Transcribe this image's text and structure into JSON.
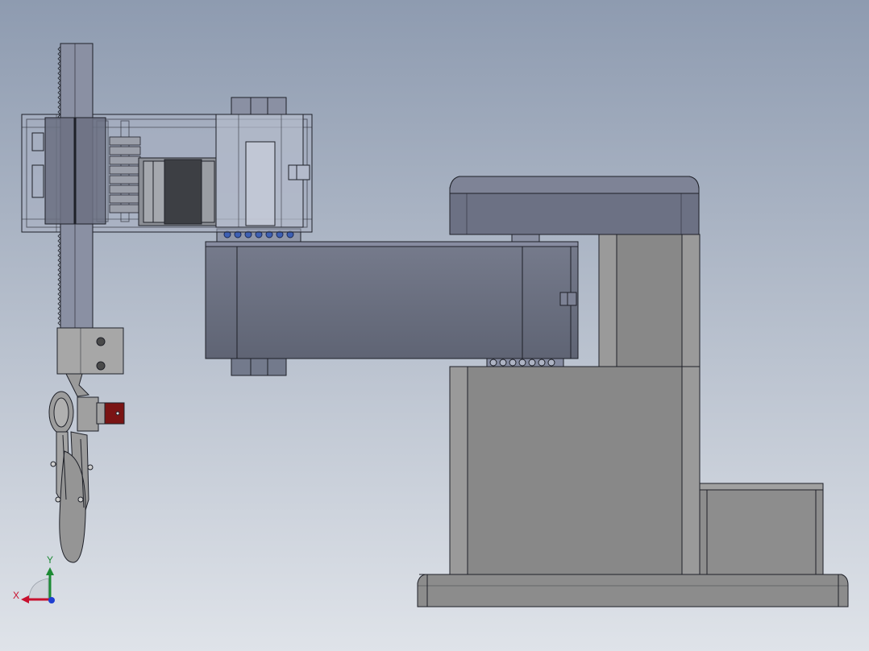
{
  "viewport": {
    "background_top": "#8e9bb0",
    "background_bottom": "#dfe3e9"
  },
  "triad": {
    "x_label": "X",
    "y_label": "Y",
    "x_color": "#c8102e",
    "y_color": "#1d8a34",
    "z_color": "#1f3fd1"
  },
  "colors": {
    "edge": "#1e2028",
    "arm_fill": "#6a6f80",
    "arm_top": "#7b8094",
    "base_fill": "#898989",
    "base_light": "#a3a3a3",
    "base_dark": "#7a7a7a",
    "transparent_fill": "#a9b0c2",
    "motor_dark": "#3d3f44",
    "gripper_fill": "#9a9a9a",
    "sensor_red": "#7a1414",
    "bearing_blue": "#3d5fb3"
  }
}
